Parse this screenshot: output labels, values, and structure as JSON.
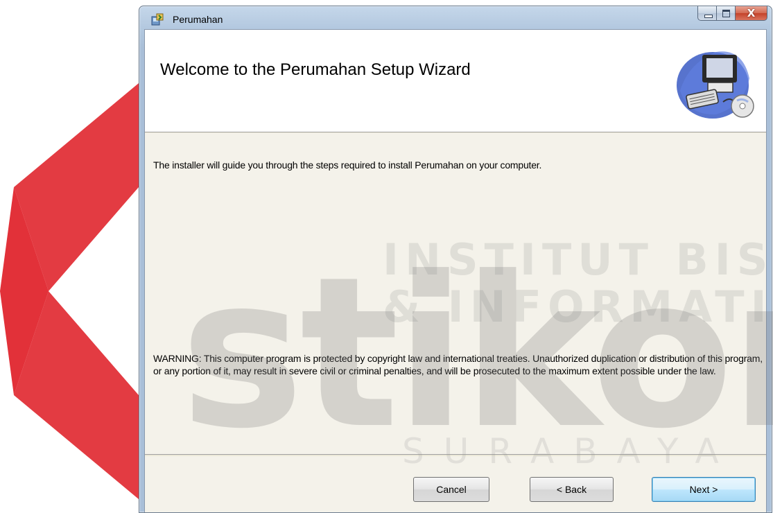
{
  "window": {
    "title": "Perumahan",
    "controls": {
      "minimize": "minimize",
      "maximize": "maximize",
      "close": "X"
    }
  },
  "banner": {
    "title": "Welcome to the Perumahan Setup Wizard",
    "image_icon": "computer-cd-clipart-icon"
  },
  "content": {
    "intro": "The installer will guide you through the steps required to install Perumahan on your computer.",
    "warning": "WARNING: This computer program is protected by copyright law and international treaties. Unauthorized duplication or distribution of this program, or any portion of it, may result in severe civil or criminal penalties, and will be prosecuted to the maximum extent possible under the law."
  },
  "buttons": {
    "cancel": "Cancel",
    "back": "< Back",
    "next": "Next >"
  },
  "watermark": {
    "line1": "INSTITUT BISNIS",
    "line2": "& INFORMATIKA",
    "brand": "stikom",
    "city": "SURABAYA",
    "logo_color": "#e0262e"
  }
}
